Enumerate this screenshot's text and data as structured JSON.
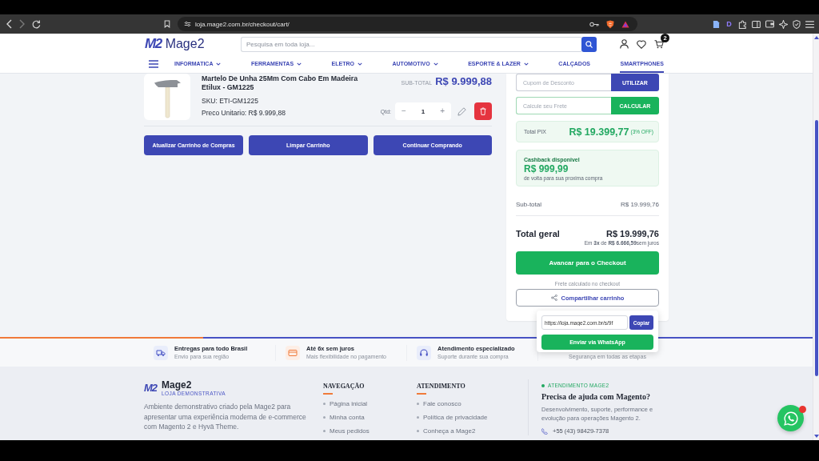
{
  "browser": {
    "url": "loja.mage2.com.br/checkout/cart/",
    "extension_letter": "D"
  },
  "header": {
    "logo_mark": "M2",
    "logo_text": "Mage2",
    "search": {
      "placeholder": "Pesquisa em toda loja..."
    },
    "cart_count": "2",
    "nav": [
      {
        "label": "INFORMATICA",
        "dropdown": true,
        "selected": false
      },
      {
        "label": "FERRAMENTAS",
        "dropdown": true,
        "selected": false
      },
      {
        "label": "ELETRO",
        "dropdown": true,
        "selected": false
      },
      {
        "label": "AUTOMOTIVO",
        "dropdown": true,
        "selected": false
      },
      {
        "label": "ESPORTE & LAZER",
        "dropdown": true,
        "selected": false
      },
      {
        "label": "CALÇADOS",
        "dropdown": false,
        "selected": false
      },
      {
        "label": "SMARTPHONES",
        "dropdown": false,
        "selected": true
      }
    ]
  },
  "cart_item": {
    "title": "Martelo De Unha 25Mm Com Cabo Em Madeira Etilux - GM1225",
    "sku": "SKU: ETI-GM1225",
    "unit_price": "Preco Unitario: R$ 9.999,88",
    "subtotal_label": "SUB-TOTAL",
    "subtotal": "R$ 9.999,88",
    "qty_label": "Qtd:",
    "minus": "−",
    "qty": "1",
    "plus": "+"
  },
  "cart_actions": [
    "Atualizar Carrinho de Compras",
    "Limpar Carrinho",
    "Continuar Comprando"
  ],
  "summary": {
    "coupon": {
      "placeholder": "Cupom de Desconto",
      "button": "UTILIZAR"
    },
    "shipping": {
      "placeholder": "Calcule seu Frete",
      "button": "CALCULAR"
    },
    "pix": {
      "label": "Total PIX",
      "value": "R$ 19.399,77",
      "note": "(3% OFF)"
    },
    "cashback": {
      "title": "Cashback disponivel",
      "value": "R$ 999,99",
      "note": "de volta para sua proxima compra"
    },
    "subtotal": {
      "label": "Sub-total",
      "value": "R$ 19.999,76"
    },
    "total": {
      "label": "Total geral",
      "value": "R$ 19.999,76",
      "installments": "Em **3x** de **R$ 6.666,59**sem juros"
    },
    "checkout_button": "Avancar para o Checkout",
    "shipping_note": "Frete calculado no checkout",
    "share_button": "Compartilhar carrinho"
  },
  "share_popup": {
    "link": "https://loja.mage2.com.br/s/9f",
    "copy_button": "Copiar",
    "whatsapp_button": "Enviar via WhatsApp"
  },
  "features": [
    {
      "kind": "truck",
      "title": "Entregas para todo Brasil",
      "subtitle": "Envio para sua região"
    },
    {
      "kind": "card",
      "title": "Até 6x sem juros",
      "subtitle": "Mais flexibilidade no pagamento"
    },
    {
      "kind": "headset",
      "title": "Atendimento especializado",
      "subtitle": "Suporte durante sua compra"
    },
    {
      "subtitle": "Segurança em todas as etapas"
    }
  ],
  "footer": {
    "logo_mark": "M2",
    "brand": "Mage2",
    "tagline": "LOJA DEMONSTRATIVA",
    "description": "Ambiente demonstrativo criado pela Mage2 para apresentar uma experiência moderna de e-commerce com Magento 2 e Hyvä Theme.",
    "columns": [
      {
        "title": "NAVEGAÇÃO",
        "links": [
          "Página inicial",
          "Minha conta",
          "Meus pedidos"
        ]
      },
      {
        "title": "ATENDIMENTO",
        "links": [
          "Fale conosco",
          "Política de privacidade",
          "Conheça a Mage2"
        ]
      }
    ],
    "support": {
      "eyebrow": "ATENDIMENTO MAGE2",
      "title": "Precisa de ajuda com Magento?",
      "text": "Desenvolvimento, suporte, performance e evolução para operações Magento 2.",
      "phone": "+55 (43) 98429-7378"
    }
  }
}
